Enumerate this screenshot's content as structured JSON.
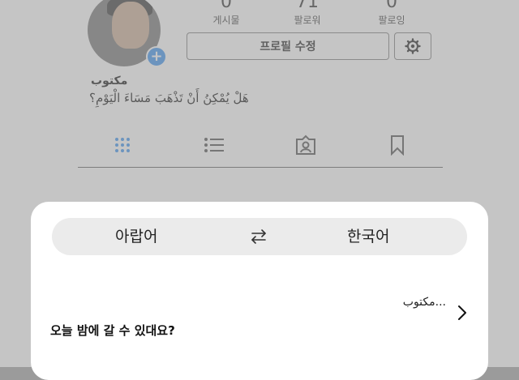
{
  "profile": {
    "stats": [
      {
        "value": "0",
        "label": "게시물"
      },
      {
        "value": "71",
        "label": "팔로워"
      },
      {
        "value": "0",
        "label": "팔로잉"
      }
    ],
    "edit_profile_label": "프로필 수정",
    "username": "مكتوب",
    "bio": "هَلْ يُمْكِنُ أَنْ تَذْهَبَ مَسَاءَ الْيَوْمِ؟",
    "tabs": [
      "grid-icon",
      "list-icon",
      "tagged-icon",
      "bookmark-icon"
    ]
  },
  "translator": {
    "source_language": "아랍어",
    "target_language": "한국어",
    "source_text": "مكتوب...",
    "translated_text": "오늘 밤에 갈 수 있대요?",
    "colors": {
      "sheet": "#ffffff",
      "lang_bar": "#ebebeb",
      "accent": "#2d8cf0"
    }
  }
}
